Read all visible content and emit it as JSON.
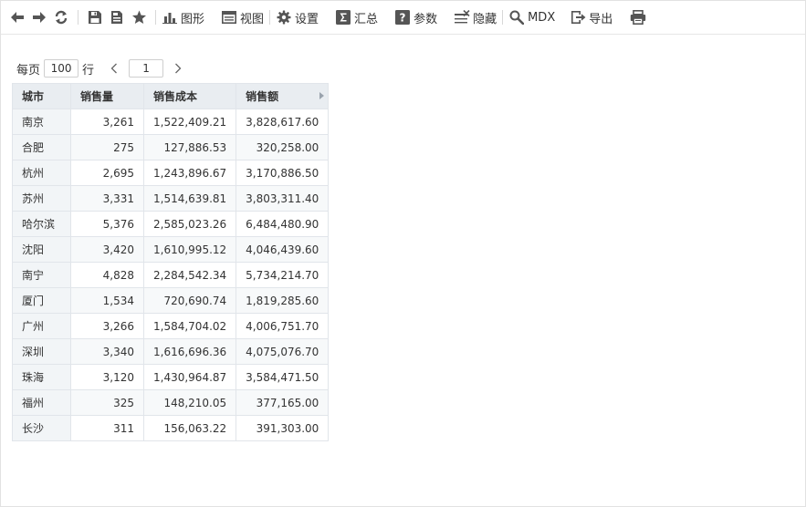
{
  "toolbar": {
    "chart_label": "图形",
    "view_label": "视图",
    "settings_label": "设置",
    "summary_label": "汇总",
    "params_label": "参数",
    "hide_label": "隐藏",
    "mdx_label": "MDX",
    "export_label": "导出"
  },
  "pager": {
    "per_page_label": "每页",
    "page_size": "100",
    "rows_label": "行",
    "current_page": "1"
  },
  "table": {
    "headers": [
      "城市",
      "销售量",
      "销售成本",
      "销售额"
    ],
    "rows": [
      [
        "南京",
        "3,261",
        "1,522,409.21",
        "3,828,617.60"
      ],
      [
        "合肥",
        "275",
        "127,886.53",
        "320,258.00"
      ],
      [
        "杭州",
        "2,695",
        "1,243,896.67",
        "3,170,886.50"
      ],
      [
        "苏州",
        "3,331",
        "1,514,639.81",
        "3,803,311.40"
      ],
      [
        "哈尔滨",
        "5,376",
        "2,585,023.26",
        "6,484,480.90"
      ],
      [
        "沈阳",
        "3,420",
        "1,610,995.12",
        "4,046,439.60"
      ],
      [
        "南宁",
        "4,828",
        "2,284,542.34",
        "5,734,214.70"
      ],
      [
        "厦门",
        "1,534",
        "720,690.74",
        "1,819,285.60"
      ],
      [
        "广州",
        "3,266",
        "1,584,704.02",
        "4,006,751.70"
      ],
      [
        "深圳",
        "3,340",
        "1,616,696.36",
        "4,075,076.70"
      ],
      [
        "珠海",
        "3,120",
        "1,430,964.87",
        "3,584,471.50"
      ],
      [
        "福州",
        "325",
        "148,210.05",
        "377,165.00"
      ],
      [
        "长沙",
        "311",
        "156,063.22",
        "391,303.00"
      ]
    ]
  }
}
